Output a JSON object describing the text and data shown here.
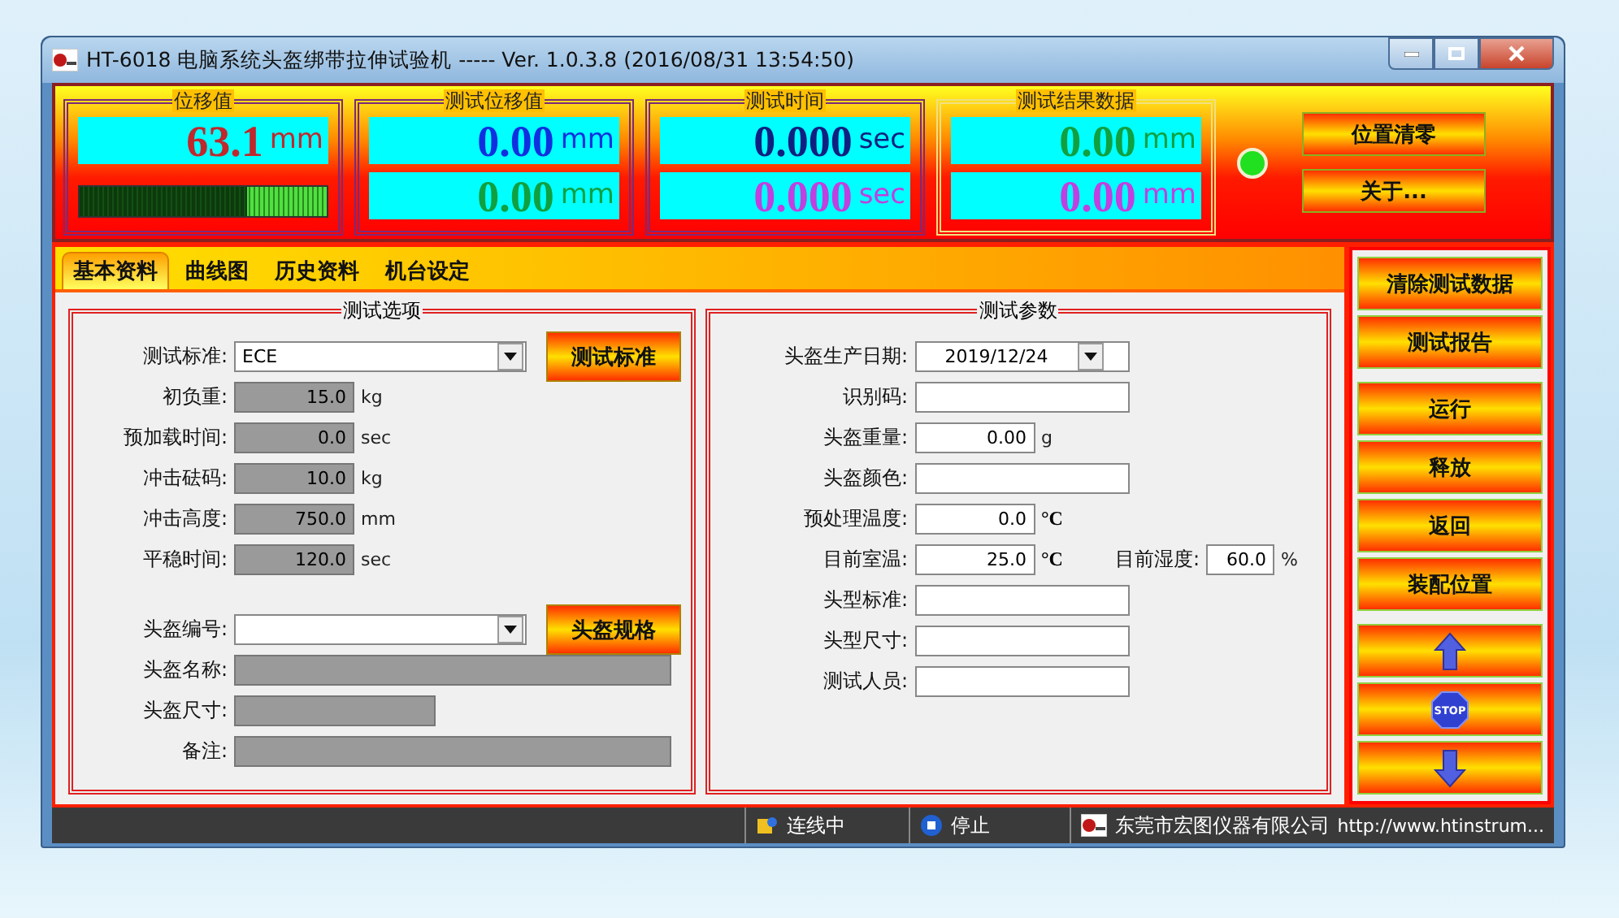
{
  "window": {
    "title": "HT-6018 电脑系统头盔绑带拉伸试验机 ----- Ver. 1.0.3.8 (2016/08/31 13:54:50)"
  },
  "displays": [
    {
      "title": "位移值",
      "color": "#7a2a7a",
      "rows": [
        {
          "value": "63.1",
          "unit": "mm",
          "color": "#c0282c"
        }
      ],
      "meter": {
        "level": 0.68
      }
    },
    {
      "title": "测试位移值",
      "color": "#7a2a7a",
      "rows": [
        {
          "value": "0.00",
          "unit": "mm",
          "color": "#1030e0"
        },
        {
          "value": "0.00",
          "unit": "mm",
          "color": "#10a040"
        }
      ]
    },
    {
      "title": "测试时间",
      "color": "#7a2a7a",
      "rows": [
        {
          "value": "0.000",
          "unit": "sec",
          "color": "#102080"
        },
        {
          "value": "0.000",
          "unit": "sec",
          "color": "#c040e0"
        }
      ]
    },
    {
      "title": "测试结果数据",
      "color": "#f0e080",
      "rows": [
        {
          "value": "0.00",
          "unit": "mm",
          "color": "#10a040"
        },
        {
          "value": "0.00",
          "unit": "mm",
          "color": "#c040e0"
        }
      ]
    }
  ],
  "indicator": {
    "on": true
  },
  "top_buttons": [
    "位置清零",
    "关于..."
  ],
  "tabs": [
    {
      "label": "基本资料",
      "selected": true
    },
    {
      "label": "曲线图",
      "selected": false
    },
    {
      "label": "历史资料",
      "selected": false
    },
    {
      "label": "机台设定",
      "selected": false
    }
  ],
  "options": {
    "title": "测试选项",
    "fields": [
      {
        "label": "测试标准:",
        "kind": "combo",
        "value": "ECE",
        "button": "测试标准"
      },
      {
        "label": "初负重:",
        "kind": "readonly-number",
        "value": "15.0",
        "unit": "kg"
      },
      {
        "label": "预加载时间:",
        "kind": "readonly-number",
        "value": "0.0",
        "unit": "sec"
      },
      {
        "label": "冲击砝码:",
        "kind": "readonly-number",
        "value": "10.0",
        "unit": "kg"
      },
      {
        "label": "冲击高度:",
        "kind": "readonly-number",
        "value": "750.0",
        "unit": "mm"
      },
      {
        "label": "平稳时间:",
        "kind": "readonly-number",
        "value": "120.0",
        "unit": "sec"
      },
      {
        "label": "头盔编号:",
        "kind": "combo",
        "button": "头盔规格"
      },
      {
        "label": "头盔名称:",
        "kind": "readonly-wide"
      },
      {
        "label": "头盔尺寸:",
        "kind": "readonly-short"
      },
      {
        "label": "备注:",
        "kind": "readonly-wide"
      }
    ]
  },
  "params": {
    "title": "测试参数",
    "fields": [
      {
        "label": "头盔生产日期:",
        "kind": "date",
        "value": "2019/12/24"
      },
      {
        "label": "识别码:",
        "kind": "text"
      },
      {
        "label": "头盔重量:",
        "kind": "number",
        "value": "0.00",
        "unit": "g"
      },
      {
        "label": "头盔颜色:",
        "kind": "text"
      },
      {
        "label": "预处理温度:",
        "kind": "number",
        "value": "0.0",
        "unit": "°C"
      },
      {
        "label": "目前室温:",
        "kind": "number",
        "value": "25.0",
        "unit": "°C",
        "extra": {
          "label": "目前湿度:",
          "value": "60.0",
          "unit": "%"
        }
      },
      {
        "label": "头型标准:",
        "kind": "text"
      },
      {
        "label": "头型尺寸:",
        "kind": "text"
      },
      {
        "label": "测试人员:",
        "kind": "text"
      }
    ]
  },
  "side_buttons": [
    {
      "kind": "text",
      "label": "清除测试数据"
    },
    {
      "kind": "text",
      "label": "测试报告"
    },
    {
      "kind": "text",
      "label": "运行"
    },
    {
      "kind": "text",
      "label": "释放"
    },
    {
      "kind": "text",
      "label": "返回"
    },
    {
      "kind": "text",
      "label": "装配位置"
    },
    {
      "kind": "up"
    },
    {
      "kind": "stop",
      "label": "STOP"
    },
    {
      "kind": "down"
    }
  ],
  "status_bar": {
    "connection": "连线中",
    "run_state": "停止",
    "company": "东莞市宏图仪器有限公司",
    "url": "http://www.htinstrum..."
  }
}
